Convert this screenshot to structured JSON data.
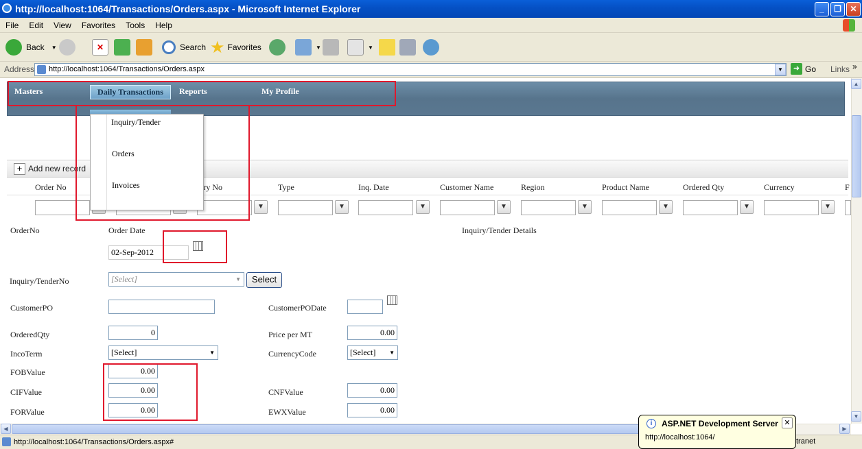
{
  "window": {
    "title": "http://localhost:1064/Transactions/Orders.aspx - Microsoft Internet Explorer"
  },
  "menu": [
    "File",
    "Edit",
    "View",
    "Favorites",
    "Tools",
    "Help"
  ],
  "toolbar": {
    "back": "Back",
    "search": "Search",
    "favorites": "Favorites"
  },
  "address": {
    "label": "Address",
    "url": "http://localhost:1064/Transactions/Orders.aspx",
    "go": "Go",
    "links": "Links"
  },
  "nav": {
    "items": [
      "Masters",
      "Daily Transactions",
      "Reports",
      "My Profile"
    ],
    "active": "Daily Transactions"
  },
  "dropdown": [
    "Inquiry/Tender",
    "Orders",
    "Invoices"
  ],
  "grid": {
    "add_new": "Add new record",
    "columns": [
      "Order No",
      "",
      "uiry No",
      "Type",
      "Inq. Date",
      "Customer Name",
      "Region",
      "Product Name",
      "Ordered Qty",
      "Currency",
      "F"
    ]
  },
  "form": {
    "order_no_label": "OrderNo",
    "order_date_label": "Order Date",
    "order_date_value": "02-Sep-2012",
    "inquiry_details_label": "Inquiry/Tender Details",
    "inquiry_no_label": "Inquiry/TenderNo",
    "inquiry_select_placeholder": "[Select]",
    "select_button": "Select",
    "customer_po_label": "CustomerPO",
    "customer_po_date_label": "CustomerPODate",
    "ordered_qty_label": "OrderedQty",
    "ordered_qty_value": "0",
    "price_label": "Price per MT",
    "price_value": "0.00",
    "incoterm_label": "IncoTerm",
    "incoterm_value": "[Select]",
    "currency_code_label": "CurrencyCode",
    "currency_code_value": "[Select]",
    "fob_label": "FOBValue",
    "fob_value": "0.00",
    "cif_label": "CIFValue",
    "cif_value": "0.00",
    "cnf_label": "CNFValue",
    "cnf_value": "0.00",
    "for_label": "FORValue",
    "for_value": "0.00",
    "ewx_label": "EWXValue",
    "ewx_value": "0.00"
  },
  "status": {
    "url": "http://localhost:1064/Transactions/Orders.aspx#",
    "zone": "tranet"
  },
  "popup": {
    "title": "ASP.NET Development Server",
    "url": "http://localhost:1064/"
  }
}
